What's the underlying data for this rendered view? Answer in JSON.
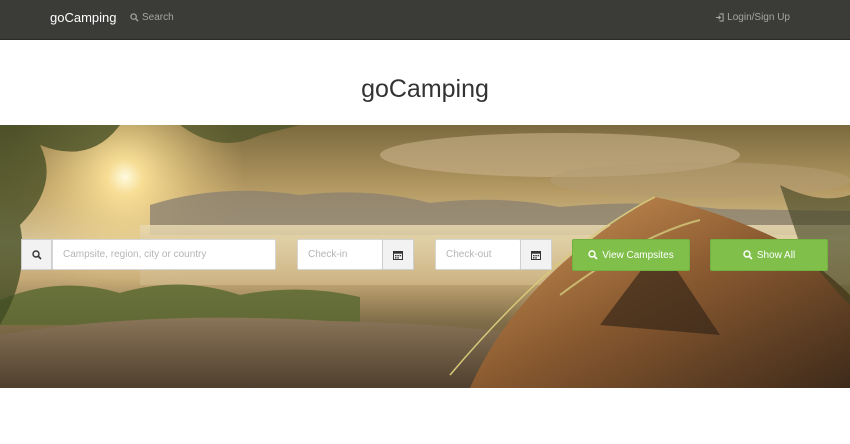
{
  "navbar": {
    "brand": "goCamping",
    "search_label": "Search",
    "login_label": "Login/Sign Up"
  },
  "page": {
    "title": "goCamping"
  },
  "search_form": {
    "location_placeholder": "Campsite, region, city or country",
    "checkin_placeholder": "Check-in",
    "checkout_placeholder": "Check-out",
    "view_button": "View Campsites",
    "show_all_button": "Show All"
  },
  "colors": {
    "navbar_bg": "#3b3b38",
    "button_green": "#7fbf4a"
  }
}
